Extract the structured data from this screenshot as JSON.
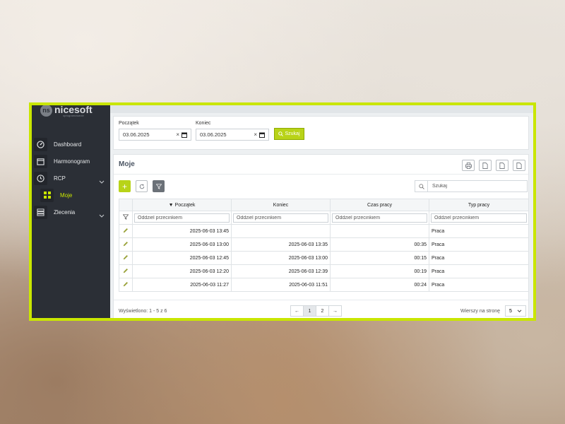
{
  "brand": {
    "name": "nicesoft",
    "mark": "ns",
    "tagline": "oprogramowanie"
  },
  "sidebar": {
    "items": [
      {
        "label": "Dashboard",
        "icon": "gauge-icon"
      },
      {
        "label": "Harmonogram",
        "icon": "calendar-icon"
      },
      {
        "label": "RCP",
        "icon": "clock-icon"
      },
      {
        "label": "Moje",
        "icon": "grid-icon"
      },
      {
        "label": "Zlecenia",
        "icon": "dots-grid-icon"
      }
    ]
  },
  "filter": {
    "start_label": "Początek",
    "start_value": "03.06.2025",
    "end_label": "Koniec",
    "end_value": "03.06.2025",
    "search_button": "Szukaj"
  },
  "list": {
    "title": "Moje",
    "search_placeholder": "Szukaj",
    "columns": [
      "Początek",
      "Koniec",
      "Czas pracy",
      "Typ pracy"
    ],
    "filter_placeholder": "Oddziel przecinkiem",
    "rows": [
      {
        "start": "2025-06-03 13:45",
        "end": "",
        "duration": "",
        "type": "Praca"
      },
      {
        "start": "2025-06-03 13:00",
        "end": "2025-06-03 13:35",
        "duration": "00:35",
        "type": "Praca"
      },
      {
        "start": "2025-06-03 12:45",
        "end": "2025-06-03 13:00",
        "duration": "00:15",
        "type": "Praca"
      },
      {
        "start": "2025-06-03 12:20",
        "end": "2025-06-03 12:39",
        "duration": "00:19",
        "type": "Praca"
      },
      {
        "start": "2025-06-03 11:27",
        "end": "2025-06-03 11:51",
        "duration": "00:24",
        "type": "Praca"
      }
    ]
  },
  "footer": {
    "info": "Wyświetlono: 1 - 5 z 6",
    "prev": "←",
    "pages": [
      "1",
      "2"
    ],
    "next": "→",
    "rows_label": "Wierszy na stronę",
    "rows_value": "5"
  },
  "colors": {
    "accent": "#c9e600",
    "button_green": "#b8d318",
    "sidebar": "#2b2f36"
  }
}
